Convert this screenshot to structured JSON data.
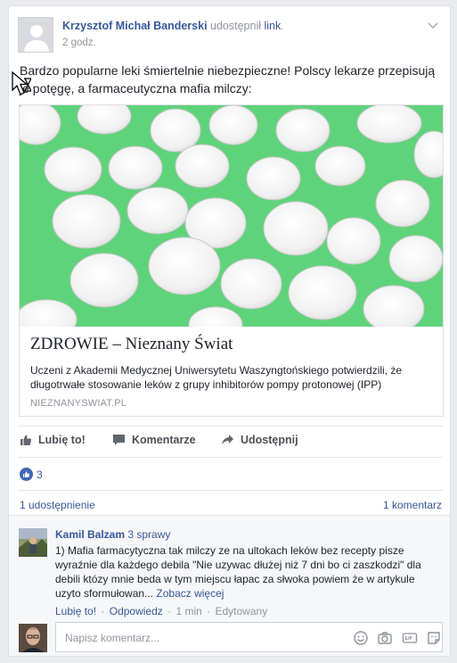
{
  "post": {
    "author": "Krzysztof Michał Banderski",
    "shared_text": " udostępnił ",
    "link_text": "link",
    "link_end": ".",
    "time": "2 godz.",
    "text": "Bardzo popularne leki śmiertelnie niebezpieczne! Polscy lekarze przepisują je potęgę, a farmaceutyczna mafia milczy:"
  },
  "attachment": {
    "title": "ZDROWIE – Nieznany Świat",
    "description": "Uczeni z Akademii Medycznej Uniwersytetu Waszyngtońskiego potwierdzili, że długotrwałe stosowanie leków z grupy inhibitorów pompy protonowej (IPP)",
    "domain": "NIEZNANYSWIAT.PL"
  },
  "actions": {
    "like": "Lubię to!",
    "comment": "Komentarze",
    "share": "Udostępnij"
  },
  "stats": {
    "reactions": "3",
    "shares": "1 udostępnienie",
    "comments": "1 komentarz"
  },
  "comment": {
    "author": "Kamil Balzam",
    "meta": "3 sprawy",
    "text": "1) Mafia farmacytyczna tak milczy ze na ultokach leków bez recepty pisze wyraźnie dla każdego debila \"Nie uzywac dłużej niż 7 dni bo ci zaszkodzi\" dla debili któzy mnie beda w tym miejscu łapac za słwoka powiem że w artykule uzyto sformułowan...",
    "more": "Zobacz więcej",
    "like": "Lubię to!",
    "reply": "Odpowiedz",
    "time": "1 min",
    "edited": "Edytowany"
  },
  "composer": {
    "placeholder": "Napisz komentarz..."
  },
  "colors": {
    "link": "#365899",
    "accent": "#4267b2",
    "photo_bg": "#5fd37a"
  },
  "icons": [
    "chevron-down-icon",
    "like-icon",
    "comment-icon",
    "share-icon",
    "emoji-icon",
    "camera-icon",
    "gif-icon",
    "sticker-icon",
    "mouse-cursor-icon"
  ]
}
